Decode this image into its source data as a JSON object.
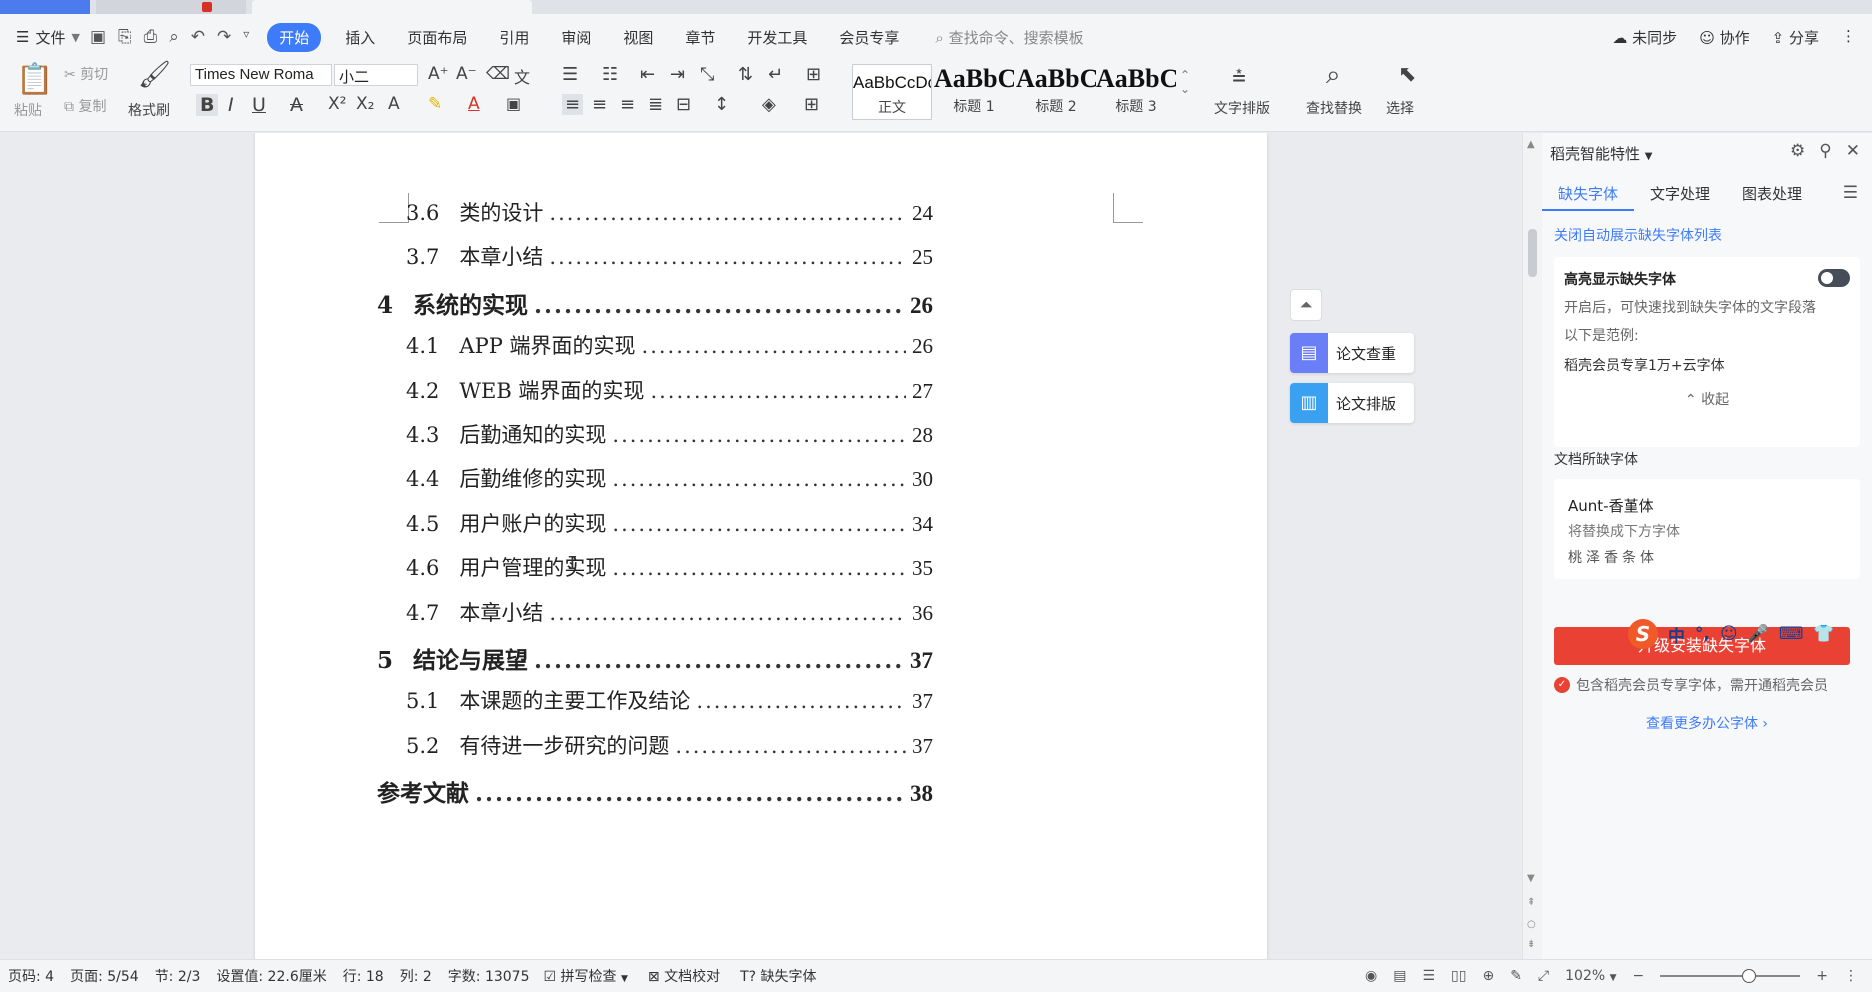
{
  "menubar": {
    "file": "文件",
    "tabs": [
      "开始",
      "插入",
      "页面布局",
      "引用",
      "审阅",
      "视图",
      "章节",
      "开发工具",
      "会员专享"
    ],
    "active_tab": "开始",
    "search_placeholder": "查找命令、搜索模板",
    "right": [
      "未同步",
      "协作",
      "分享"
    ]
  },
  "ribbon": {
    "paste": "粘贴",
    "cut": "剪切",
    "copy": "复制",
    "format_painter": "格式刷",
    "font_name": "Times New Roma",
    "font_size": "小二",
    "styles": [
      {
        "preview": "AaBbCcDc",
        "label": "正文"
      },
      {
        "preview": "AaBbC",
        "label": "标题 1"
      },
      {
        "preview": "AaBbC",
        "label": "标题 2"
      },
      {
        "preview": "AaBbC",
        "label": "标题 3"
      }
    ],
    "text_layout": "文字排版",
    "find_replace": "查找替换",
    "select": "选择"
  },
  "toc": [
    {
      "num": "3.6",
      "title": "类的设计",
      "page": "24",
      "level": 2
    },
    {
      "num": "3.7",
      "title": "本章小结",
      "page": "25",
      "level": 2
    },
    {
      "num": "4",
      "title": "系统的实现",
      "page": "26",
      "level": 1
    },
    {
      "num": "4.1",
      "title": "APP 端界面的实现",
      "page": "26",
      "level": 2
    },
    {
      "num": "4.2",
      "title": "WEB 端界面的实现",
      "page": "27",
      "level": 2
    },
    {
      "num": "4.3",
      "title": "后勤通知的实现",
      "page": "28",
      "level": 2
    },
    {
      "num": "4.4",
      "title": "后勤维修的实现",
      "page": "30",
      "level": 2
    },
    {
      "num": "4.5",
      "title": "用户账户的实现",
      "page": "34",
      "level": 2
    },
    {
      "num": "4.6",
      "title": "用户管理的实现",
      "page": "35",
      "level": 2
    },
    {
      "num": "4.7",
      "title": "本章小结",
      "page": "36",
      "level": 2
    },
    {
      "num": "5",
      "title": "结论与展望",
      "page": "37",
      "level": 1
    },
    {
      "num": "5.1",
      "title": "本课题的主要工作及结论",
      "page": "37",
      "level": 2
    },
    {
      "num": "5.2",
      "title": "有待进一步研究的问题",
      "page": "37",
      "level": 2
    },
    {
      "num": "",
      "title": "参考文献",
      "page": "38",
      "level": 1
    }
  ],
  "float": {
    "check": "论文查重",
    "layout": "论文排版"
  },
  "panel": {
    "header": "稻壳智能特性",
    "tabs": [
      "缺失字体",
      "文字处理",
      "图表处理"
    ],
    "close_auto": "关闭自动展示缺失字体列表",
    "highlight_title": "高亮显示缺失字体",
    "highlight_desc1": "开启后，可快速找到缺失字体的文字段落",
    "highlight_desc2": "以下是范例:",
    "highlight_example": "稻壳会员专享1万+云字体",
    "collapse": "收起",
    "missing_title": "文档所缺字体",
    "missing_font": "Aunt-香堇体",
    "replace_hint": "将替换成下方字体",
    "replace_font": "桃泽香条体",
    "install_btn": "升级安装缺失字体",
    "note": "包含稻壳会员专享字体，需开通稻壳会员",
    "more": "查看更多办公字体"
  },
  "status": {
    "page_code": "页码: 4",
    "page": "页面: 5/54",
    "section": "节: 2/3",
    "set_value": "设置值: 22.6厘米",
    "row": "行: 18",
    "col": "列: 2",
    "word_count": "字数: 13075",
    "spell": "拼写检查",
    "doc_check": "文档校对",
    "missing_font": "缺失字体",
    "zoom": "102%"
  }
}
